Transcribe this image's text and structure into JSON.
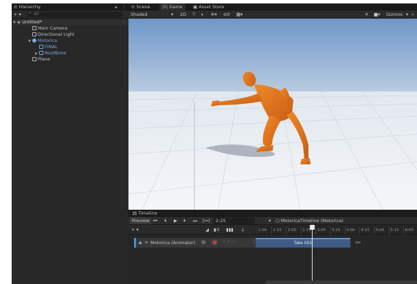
{
  "hierarchy": {
    "tab_label": "Hierarchy",
    "add_label": "+ ▾",
    "search_placeholder": "All",
    "scene_name": "Untitled*",
    "items": [
      {
        "label": "Main Camera"
      },
      {
        "label": "Directional Light"
      },
      {
        "label": "Motorica"
      },
      {
        "label": "FINAL"
      },
      {
        "label": "RootBone"
      },
      {
        "label": "Plane"
      }
    ]
  },
  "scene": {
    "tabs": [
      {
        "label": "Scene"
      },
      {
        "label": "Game"
      },
      {
        "label": "Asset Store"
      }
    ],
    "shading_mode": "Shaded",
    "mode_2d": "2D",
    "gizmos_label": "Gizmos",
    "all_label": "All",
    "colors": {
      "sky_top": "#6f97c8",
      "sky_bottom": "#b5c9dd",
      "ground": "#eef1f5",
      "character": "#e0741a"
    }
  },
  "timeline": {
    "tab_label": "Timeline",
    "preview_label": "Preview",
    "time_value": "2:25",
    "asset_label": "MotoricaTimeline (Motorica)",
    "track_label": "Motorica (Animator)",
    "clip_label": "Take 001",
    "ruler_labels": [
      "1:00",
      "1:15",
      "2:00",
      "2:15",
      "3:00",
      "3:15",
      "4:00",
      "4:15",
      "5:00",
      "5:15",
      "6:00"
    ],
    "playhead_fraction": 0.35
  }
}
